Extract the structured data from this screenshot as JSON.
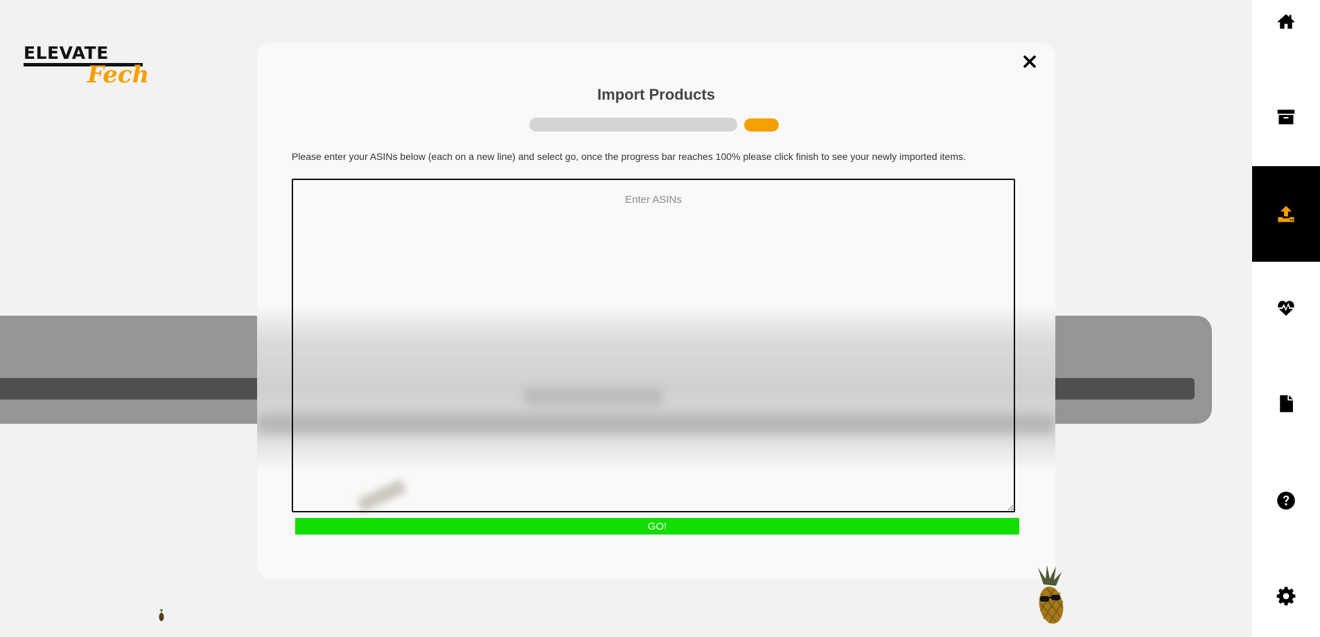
{
  "logo": {
    "line1": "ELEVATE",
    "line2": "Fech",
    "accent": "#f5a000"
  },
  "sidebar": {
    "items": [
      {
        "icon": "home-icon"
      },
      {
        "icon": "archive-icon"
      },
      {
        "icon": "upload-icon",
        "active": true
      },
      {
        "icon": "heartbeat-icon"
      },
      {
        "icon": "file-icon"
      },
      {
        "icon": "question-icon"
      },
      {
        "icon": "gear-icon"
      }
    ],
    "active_color": "#f5a000"
  },
  "modal": {
    "title": "Import Products",
    "progress": 0,
    "instructions": "Please enter your ASINs below (each on a new line) and select go, once the progress bar reaches 100% please click finish to see your newly imported items.",
    "input": {
      "placeholder": "Enter ASINs",
      "value": ""
    },
    "go_label": "GO!",
    "go_color": "#12de00"
  }
}
